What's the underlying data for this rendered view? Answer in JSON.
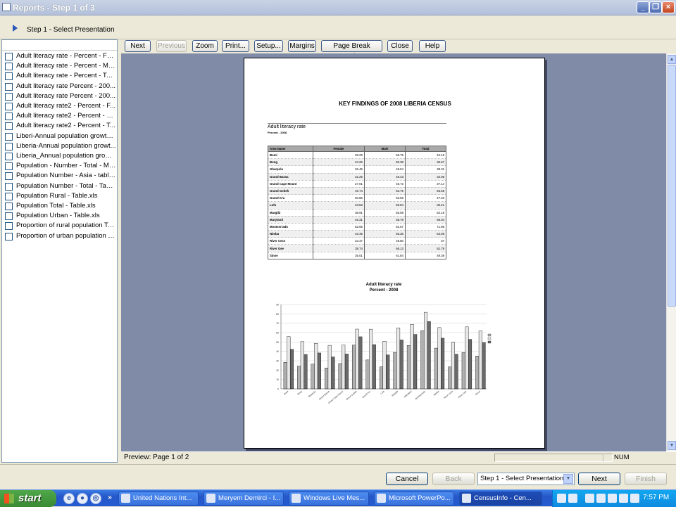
{
  "window": {
    "title": "Reports - Step 1 of 3",
    "step_label": "Step 1 - Select Presentation"
  },
  "toolbar": {
    "next": "Next",
    "previous": "Previous",
    "zoom": "Zoom",
    "print": "Print...",
    "setup": "Setup...",
    "margins": "Margins",
    "page_break_preview": "Page Break Preview",
    "close": "Close",
    "help": "Help"
  },
  "files": [
    "Adult literacy rate - Percent - Fe...",
    "Adult literacy rate - Percent - Mal...",
    "Adult literacy rate - Percent - Tot...",
    "Adult literacy rate Percent - 200...",
    "Adult literacy rate Percent - 200...",
    "Adult literacy rate2 - Percent - F...",
    "Adult literacy rate2 - Percent - M...",
    "Adult literacy rate2 - Percent - T...",
    "Liberi-Annual population growth ...",
    "Liberia-Annual population growt...",
    "Liberia_Annual population growt...",
    "Population - Number - Total - Ma...",
    "Population Number - Asia - table....",
    "Population Number - Total - Table...",
    "Population Rural - Table.xls",
    "Population Total - Table.xls",
    "Population Urban - Table.xls",
    "Proportion of rural population Tot...",
    "Proportion of urban population T..."
  ],
  "report": {
    "title": "KEY FINDINGS OF 2008 LIBERIA CENSUS",
    "table_title": "Adult literacy rate",
    "table_subtitle": "Percent - 2008",
    "columns": [
      "Area Name",
      "Female",
      "Male",
      "Total"
    ],
    "rows": [
      [
        "Bomi",
        "28.29",
        "55.75",
        "42.16"
      ],
      [
        "Bong",
        "24.26",
        "50.38",
        "36.67"
      ],
      [
        "Gbarpolu",
        "26.45",
        "48.54",
        "38.31"
      ],
      [
        "Grand Bassa",
        "22.26",
        "46.43",
        "34.06"
      ],
      [
        "Grand Cape Mount",
        "27.01",
        "46.73",
        "37.14"
      ],
      [
        "Grand Gedeh",
        "46.74",
        "63.75",
        "55.55"
      ],
      [
        "Grand Kru",
        "30.86",
        "63.66",
        "47.20"
      ],
      [
        "Lofa",
        "23.53",
        "50.84",
        "36.21"
      ],
      [
        "Margibi",
        "38.91",
        "65.08",
        "52.18"
      ],
      [
        "Maryland",
        "46.31",
        "68.78",
        "58.04"
      ],
      [
        "Montserrado",
        "62.05",
        "81.67",
        "71.86"
      ],
      [
        "Nimba",
        "43.45",
        "65.36",
        "54.06"
      ],
      [
        "River Cess",
        "23.47",
        "49.80",
        "37"
      ],
      [
        "River Gee",
        "38.74",
        "66.13",
        "52.79"
      ],
      [
        "Sinoe",
        "35.01",
        "61.84",
        "49.39"
      ]
    ],
    "chart_title_line1": "Adult literacy rate",
    "chart_title_line2": "Percent - 2008"
  },
  "chart_data": {
    "type": "bar",
    "title": "Adult literacy rate Percent - 2008",
    "categories": [
      "Bomi",
      "Bong",
      "Gbarpolu",
      "Grand Bassa",
      "Grand Cape Mount",
      "Grand Gedeh",
      "Grand Kru",
      "Lofa",
      "Margibi",
      "Maryland",
      "Montserrado",
      "Nimba",
      "River Cess",
      "River Gee",
      "Sinoe"
    ],
    "series": [
      {
        "values": [
          28.29,
          24.26,
          26.45,
          22.26,
          27.01,
          46.74,
          30.86,
          23.53,
          38.91,
          46.31,
          62.05,
          43.45,
          23.47,
          38.74,
          35.01
        ]
      },
      {
        "values": [
          55.75,
          50.38,
          48.54,
          46.43,
          46.73,
          63.75,
          63.66,
          50.84,
          65.08,
          68.78,
          81.67,
          65.36,
          49.8,
          66.13,
          61.84
        ]
      },
      {
        "values": [
          42.16,
          36.67,
          38.31,
          34.06,
          37.14,
          55.55,
          47.2,
          36.21,
          52.18,
          58.04,
          71.86,
          54.06,
          37,
          52.79,
          49.39
        ]
      }
    ],
    "ylim": [
      0,
      90
    ],
    "yticks": [
      0,
      10,
      20,
      30,
      40,
      50,
      60,
      70,
      80,
      90
    ],
    "grid": true,
    "legend": "right",
    "colors": [
      "#b0b0b0",
      "#e8e8e8",
      "#6a6a6a"
    ]
  },
  "status": {
    "preview_page": "Preview: Page 1 of 2",
    "num": "NUM"
  },
  "wizard": {
    "cancel": "Cancel",
    "back": "Back",
    "step_select": "Step 1 - Select Presentation",
    "next": "Next",
    "finish": "Finish"
  },
  "taskbar": {
    "start": "start",
    "items": [
      "United Nations Int...",
      "Meryem Demirci - I...",
      "Windows Live Mes...",
      "Microsoft PowerPo...",
      "CensusInfo - Cen..."
    ],
    "clock": "7:57 PM"
  }
}
